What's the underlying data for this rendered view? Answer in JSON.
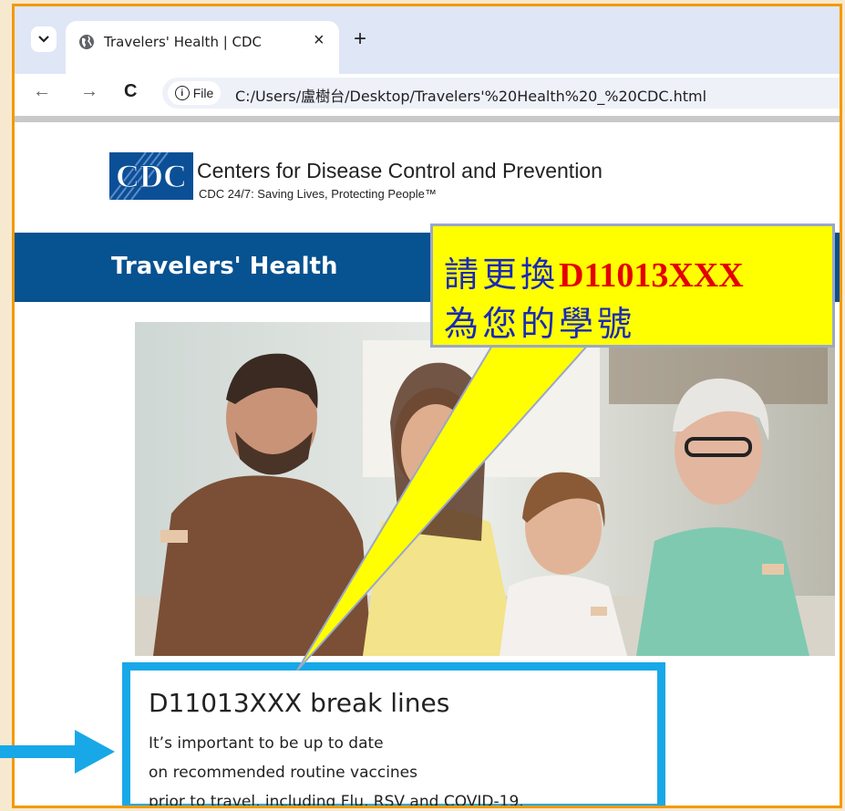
{
  "browser": {
    "tab_title": "Travelers' Health | CDC",
    "tab_close": "×",
    "new_tab": "+",
    "back_icon": "←",
    "forward_icon": "→",
    "reload_icon": "C",
    "file_label": "File",
    "url": "C:/Users/盧樹台/Desktop/Travelers'%20Health%20_%20CDC.html"
  },
  "header": {
    "logo_text": "CDC",
    "org_name": "Centers for Disease Control and Prevention",
    "tagline": "CDC 24/7: Saving Lives, Protecting People™"
  },
  "banner": {
    "title": "Travelers' Health"
  },
  "card": {
    "heading": "D11013XXX break lines",
    "lines": [
      "It’s important to be up to date",
      "on recommended routine vaccines",
      "prior to travel, including Flu, RSV and COVID-19."
    ]
  },
  "callout": {
    "line1_prefix": "請更換",
    "line1_highlight": "D11013XXX",
    "line2": "為您的學號"
  },
  "colors": {
    "frame": "#f29a00",
    "banner": "#075290",
    "card_border": "#18a8e8",
    "callout_bg": "#ffff00",
    "callout_text": "#1a29b8",
    "callout_highlight": "#e30000"
  },
  "icons": [
    "chevron-down-icon",
    "globe-icon",
    "info-icon",
    "cdc-logo",
    "arrow-right-icon"
  ]
}
